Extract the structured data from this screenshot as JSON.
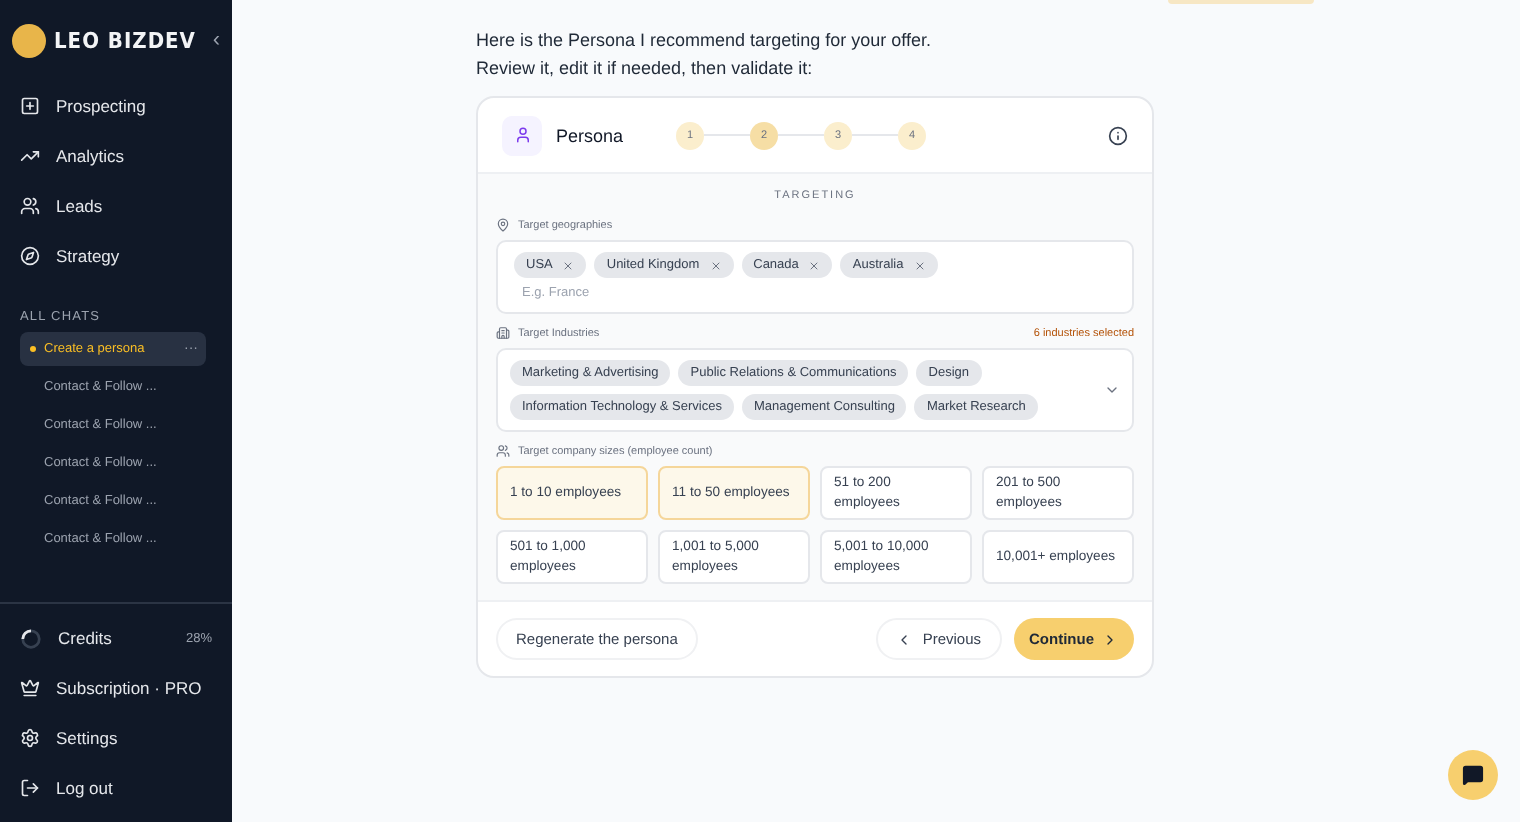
{
  "sidebar": {
    "brand": "LEO BIZDEV",
    "collapse_icon": "‹",
    "nav": [
      {
        "label": "Prospecting"
      },
      {
        "label": "Analytics"
      },
      {
        "label": "Leads"
      },
      {
        "label": "Strategy"
      }
    ],
    "chats_heading": "ALL CHATS",
    "chats": [
      {
        "label": "Create a persona",
        "selected": true,
        "more": "···"
      },
      {
        "label": "Contact & Follow ...",
        "selected": false
      },
      {
        "label": "Contact & Follow ...",
        "selected": false
      },
      {
        "label": "Contact & Follow ...",
        "selected": false
      },
      {
        "label": "Contact & Follow ...",
        "selected": false
      },
      {
        "label": "Contact & Follow ...",
        "selected": false
      }
    ],
    "credits": {
      "label": "Credits",
      "reading": "28%"
    },
    "bottom": [
      {
        "label": "Subscription · PRO"
      },
      {
        "label": "Settings"
      },
      {
        "label": "Log out"
      }
    ]
  },
  "message": [
    "Here is the Persona I recommend targeting for your offer.",
    "Review it, edit it if needed, then validate it:"
  ],
  "card": {
    "title": "Persona",
    "steps": [
      {
        "label": "1",
        "selected": false
      },
      {
        "label": "2",
        "selected": true
      },
      {
        "label": "3",
        "selected": false
      },
      {
        "label": "4",
        "selected": false
      }
    ],
    "section": "TARGETING",
    "geographies": {
      "label": "Target geographies",
      "tags": [
        "USA",
        "United Kingdom",
        "Canada",
        "Australia"
      ],
      "placeholder": "E.g. France"
    },
    "industries": {
      "label": "Target Industries",
      "count": "6 industries selected",
      "tags": [
        "Marketing & Advertising",
        "Public Relations & Communications",
        "Design",
        "Information Technology & Services",
        "Management Consulting",
        "Market Research"
      ]
    },
    "sizes": {
      "label": "Target company sizes (employee count)",
      "options": [
        {
          "label": "1 to 10 employees",
          "selected": true
        },
        {
          "label": "11 to 50 employees",
          "selected": true
        },
        {
          "label": "51 to 200 employees",
          "selected": false
        },
        {
          "label": "201 to 500 employees",
          "selected": false
        },
        {
          "label": "501 to 1,000 employees",
          "selected": false
        },
        {
          "label": "1,001 to 5,000 employees",
          "selected": false
        },
        {
          "label": "5,001 to 10,000 employees",
          "selected": false
        },
        {
          "label": "10,001+ employees",
          "selected": false
        }
      ]
    },
    "regenerate": "Regenerate the persona",
    "previous": "Previous",
    "continue": "Continue"
  }
}
